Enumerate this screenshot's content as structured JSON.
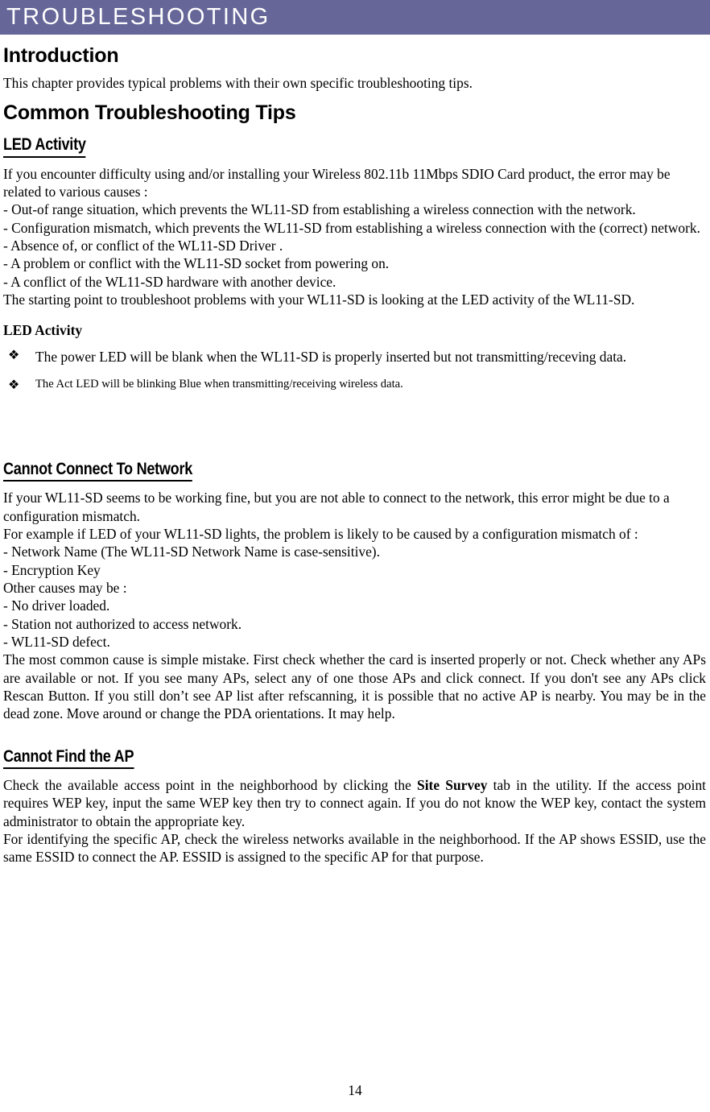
{
  "document": {
    "chapter_banner": {
      "title": "TROUBLESHOOTING",
      "background_color": "#666699",
      "text_color": "#ffffff"
    },
    "page_number": "14"
  },
  "sections": {
    "introduction": {
      "heading": "Introduction",
      "paragraph": "This chapter provides typical problems with their own specific troubleshooting tips."
    },
    "common_tips": {
      "heading": "Common Troubleshooting Tips"
    },
    "led_activity": {
      "heading": "LED Activity",
      "intro_paragraph": "If you encounter difficulty using and/or installing your Wireless 802.11b 11Mbps SDIO Card product, the error may be related to various causes :",
      "causes": [
        "- Out-of range situation, which prevents the WL11-SD from establishing a wireless connection with the network.",
        "- Configuration mismatch, which prevents the WL11-SD from establishing a wireless connection with the (correct) network.",
        "- Absence of, or conflict of the WL11-SD Driver .",
        "- A problem or conflict with the WL11-SD socket from powering on.",
        "- A conflict of the WL11-SD hardware with another device."
      ],
      "closing_paragraph": "The starting point to troubleshoot problems with your WL11-SD is looking at the LED activity of the WL11-SD.",
      "minor_heading": "LED Activity",
      "bullets": [
        {
          "glyph": "❖",
          "glyph_name": "diamond-bullet-icon",
          "text": "The power LED will be blank when the WL11-SD is properly inserted but not transmitting/receving data.",
          "size": "normal"
        },
        {
          "glyph": "❖",
          "glyph_name": "diamond-bullet-icon",
          "text": "The Act LED will be blinking Blue when transmitting/receiving wireless data.",
          "size": "small"
        }
      ]
    },
    "cannot_connect": {
      "heading": "Cannot Connect To Network",
      "paragraph_1": "If your WL11-SD seems to be working fine, but you are not able to connect to the network, this error might be due to a configuration mismatch.",
      "paragraph_2": "For example if LED of your WL11-SD lights, the problem is likely to be caused by a configuration mismatch of :",
      "mismatch_causes": [
        "- Network Name (The WL11-SD Network Name is case-sensitive).",
        "- Encryption Key"
      ],
      "other_causes_label": "Other causes may be :",
      "other_causes": [
        "- No driver loaded.",
        "- Station not authorized to access network.",
        "- WL11-SD defect."
      ],
      "closing_paragraph": "The most common cause is simple mistake. First check whether the card is inserted properly or not. Check whether any APs are available or not. If you see many APs, select any of one those APs and click connect. If you don't see any APs click Rescan Button. If you still don’t see AP list after refscanning, it is possible that no active AP is nearby. You may be in the dead zone. Move around or change the PDA orientations. It may help."
    },
    "cannot_find_ap": {
      "heading": "Cannot Find the AP",
      "paragraph_1_part_1": "Check the available access point in the neighborhood by clicking the ",
      "paragraph_1_emphasis": "Site Survey",
      "paragraph_1_part_2": " tab in the utility. If the access point requires WEP key, input the same WEP key then try to connect again. If you do not know the WEP key, contact the system administrator to obtain the appropriate key.",
      "paragraph_2": "For identifying the specific AP, check the wireless networks available in the neighborhood. If the AP shows ESSID, use the same ESSID to connect the AP. ESSID is assigned to the specific AP for that purpose."
    }
  }
}
